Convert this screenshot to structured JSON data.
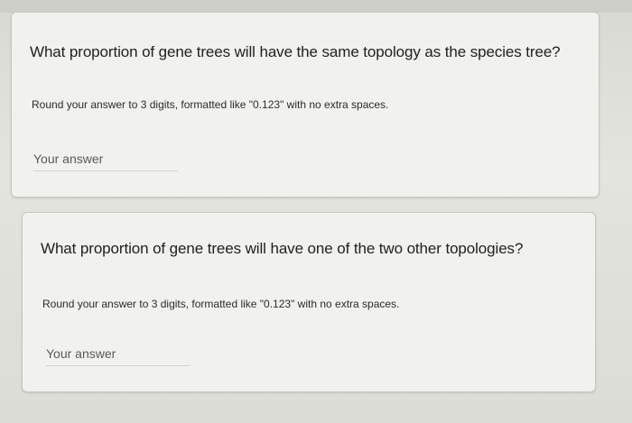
{
  "questions": [
    {
      "title": "What proportion of gene trees will have the same topology as the species tree?",
      "help": "Round your answer to 3 digits, formatted like \"0.123\" with no extra spaces.",
      "answer_placeholder": "Your answer",
      "answer_value": ""
    },
    {
      "title": "What proportion of gene trees will have one of the two other topologies?",
      "help": "Round your answer to 3 digits, formatted like \"0.123\" with no extra spaces.",
      "answer_placeholder": "Your answer",
      "answer_value": ""
    }
  ]
}
